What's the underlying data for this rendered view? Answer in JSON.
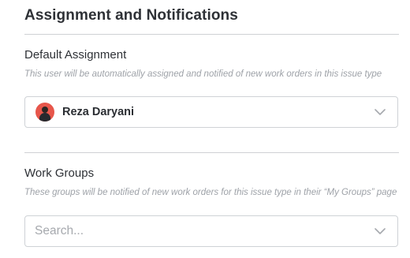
{
  "section": {
    "title": "Assignment and Notifications"
  },
  "default_assignment": {
    "label": "Default Assignment",
    "help": "This user will be automatically assigned and notified of new work orders in this issue type",
    "selected_user": "Reza Daryani",
    "avatar_icon": "user-avatar-icon"
  },
  "work_groups": {
    "label": "Work Groups",
    "help": "These groups will be notified of new work orders for this issue type in their “My Groups” page",
    "placeholder": "Search..."
  },
  "colors": {
    "avatar_background": "#e7564b",
    "border": "#cfd2d6",
    "muted_text": "#9ea2a8"
  }
}
